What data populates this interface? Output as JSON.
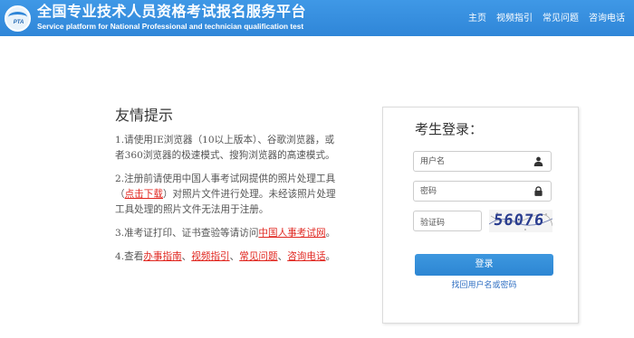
{
  "header": {
    "title": "全国专业技术人员资格考试报名服务平台",
    "subtitle": "Service platform for National Professional and technician qualification test",
    "logo_text": "PTA",
    "nav": [
      "主页",
      "视频指引",
      "常见问题",
      "咨询电话"
    ]
  },
  "tips": {
    "title": "友情提示",
    "tip1": {
      "line1": "1.请使用IE浏览器（10以上版本）、谷歌浏览器，或",
      "line2": "者360浏览器的极速模式、搜狗浏览器的高速模式。"
    },
    "tip2": {
      "line1": "2.注册前请使用中国人事考试网提供的照片处理工具",
      "line2_open": "（",
      "link": "点击下载",
      "line2_rest": "）对照片文件进行处理。未经该照片处理",
      "line3": "工具处理的照片文件无法用于注册。"
    },
    "tip3": {
      "text": "3.准考证打印、证书查验等请访问",
      "link": "中国人事考试网",
      "end": "。"
    },
    "tip4": {
      "text": "4.查看",
      "links": [
        "办事指南",
        "视频指引",
        "常见问题",
        "咨询电话"
      ],
      "sep": "、",
      "end": "。"
    }
  },
  "login": {
    "title": "考生登录：",
    "username_placeholder": "用户名",
    "password_placeholder": "密码",
    "captcha_placeholder": "验证码",
    "captcha_text": "56076",
    "button_label": "登录",
    "forgot_link": "找回用户名或密码"
  },
  "colors": {
    "header_bg": "#2f86d8",
    "link_red": "#e0261f",
    "button_blue": "#3a93dc",
    "link_blue": "#2f6fc2"
  },
  "icons": [
    "user-icon",
    "lock-icon"
  ]
}
